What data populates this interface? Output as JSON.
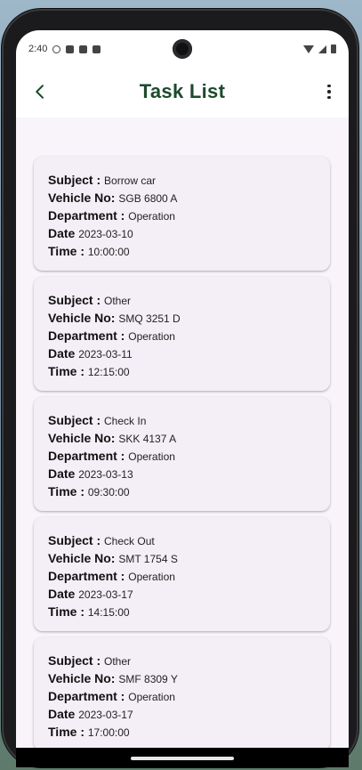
{
  "status_bar": {
    "time": "2:40"
  },
  "header": {
    "title": "Task List"
  },
  "labels": {
    "subject": "Subject : ",
    "vehicle": "Vehicle No: ",
    "department": "Department : ",
    "date": "Date ",
    "time": "Time : "
  },
  "tasks": [
    {
      "subject": "Borrow car",
      "vehicle": "SGB 6800 A",
      "department": "Operation",
      "date": "2023-03-10",
      "time": "10:00:00"
    },
    {
      "subject": "Other",
      "vehicle": "SMQ 3251 D",
      "department": "Operation",
      "date": "2023-03-11",
      "time": "12:15:00"
    },
    {
      "subject": "Check In",
      "vehicle": "SKK 4137 A",
      "department": "Operation",
      "date": "2023-03-13",
      "time": "09:30:00"
    },
    {
      "subject": "Check Out",
      "vehicle": "SMT 1754 S",
      "department": "Operation",
      "date": "2023-03-17",
      "time": "14:15:00"
    },
    {
      "subject": "Other",
      "vehicle": "SMF 8309 Y",
      "department": "Operation",
      "date": "2023-03-17",
      "time": "17:00:00"
    }
  ],
  "colors": {
    "title": "#1d4a2e",
    "card": "#f4eef7",
    "list_bg": "#f8f4fa"
  }
}
